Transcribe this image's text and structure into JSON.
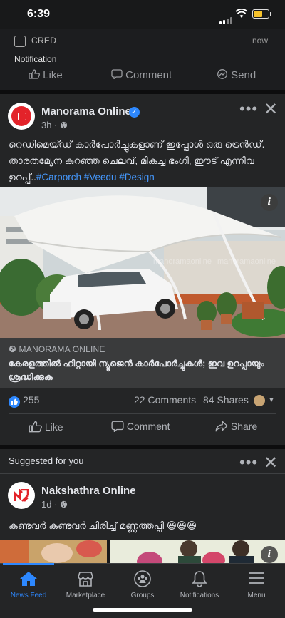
{
  "status_bar": {
    "time": "6:39"
  },
  "notification": {
    "app": "CRED",
    "time": "now",
    "title": "Notification"
  },
  "peek_actions": {
    "like": "Like",
    "comment": "Comment",
    "send": "Send"
  },
  "post": {
    "page_name": "Manorama Online",
    "time": "3h · ",
    "text_main": "റെഡിമെയ്ഡ് കാർപോർച്ചുകളാണ് ഇപ്പോൾ ഒരു ട്രെൻഡ്. താരതമ്യേന കുറഞ്ഞ ചെലവ്, മികച്ച ഭംഗി, ഈട് എന്നിവ ഉറപ്പ്..",
    "hashtags": "#Carporch #Veedu #Design",
    "watermark": "manoramaonline",
    "link_source": "MANORAMA ONLINE",
    "link_title": "കേരളത്തിൽ ഹിറ്റായി ന്യൂജെൻ കാർപോർച്ചുകൾ; ഇവ ഉറപ്പായും ശ്രദ്ധിക്കുക",
    "reactions_count": "255",
    "comments": "22 Comments",
    "shares": "84 Shares",
    "actions": {
      "like": "Like",
      "comment": "Comment",
      "share": "Share"
    }
  },
  "suggested": {
    "heading": "Suggested for you",
    "page_name": "Nakshathra Online",
    "time": "1d · ",
    "text": "കണ്ടവർ കണ്ടവർ ചിരിച്ച് മണ്ണുത്തപ്പി 😆😆😆"
  },
  "tabs": [
    {
      "label": "News Feed",
      "icon": "home-icon",
      "active": true
    },
    {
      "label": "Marketplace",
      "icon": "marketplace-icon",
      "active": false
    },
    {
      "label": "Groups",
      "icon": "groups-icon",
      "active": false
    },
    {
      "label": "Notifications",
      "icon": "bell-icon",
      "active": false
    },
    {
      "label": "Menu",
      "icon": "menu-icon",
      "active": false
    }
  ],
  "colors": {
    "accent": "#2d88ff",
    "background": "#18191a",
    "card": "#242526",
    "brand_red": "#e3232a"
  }
}
